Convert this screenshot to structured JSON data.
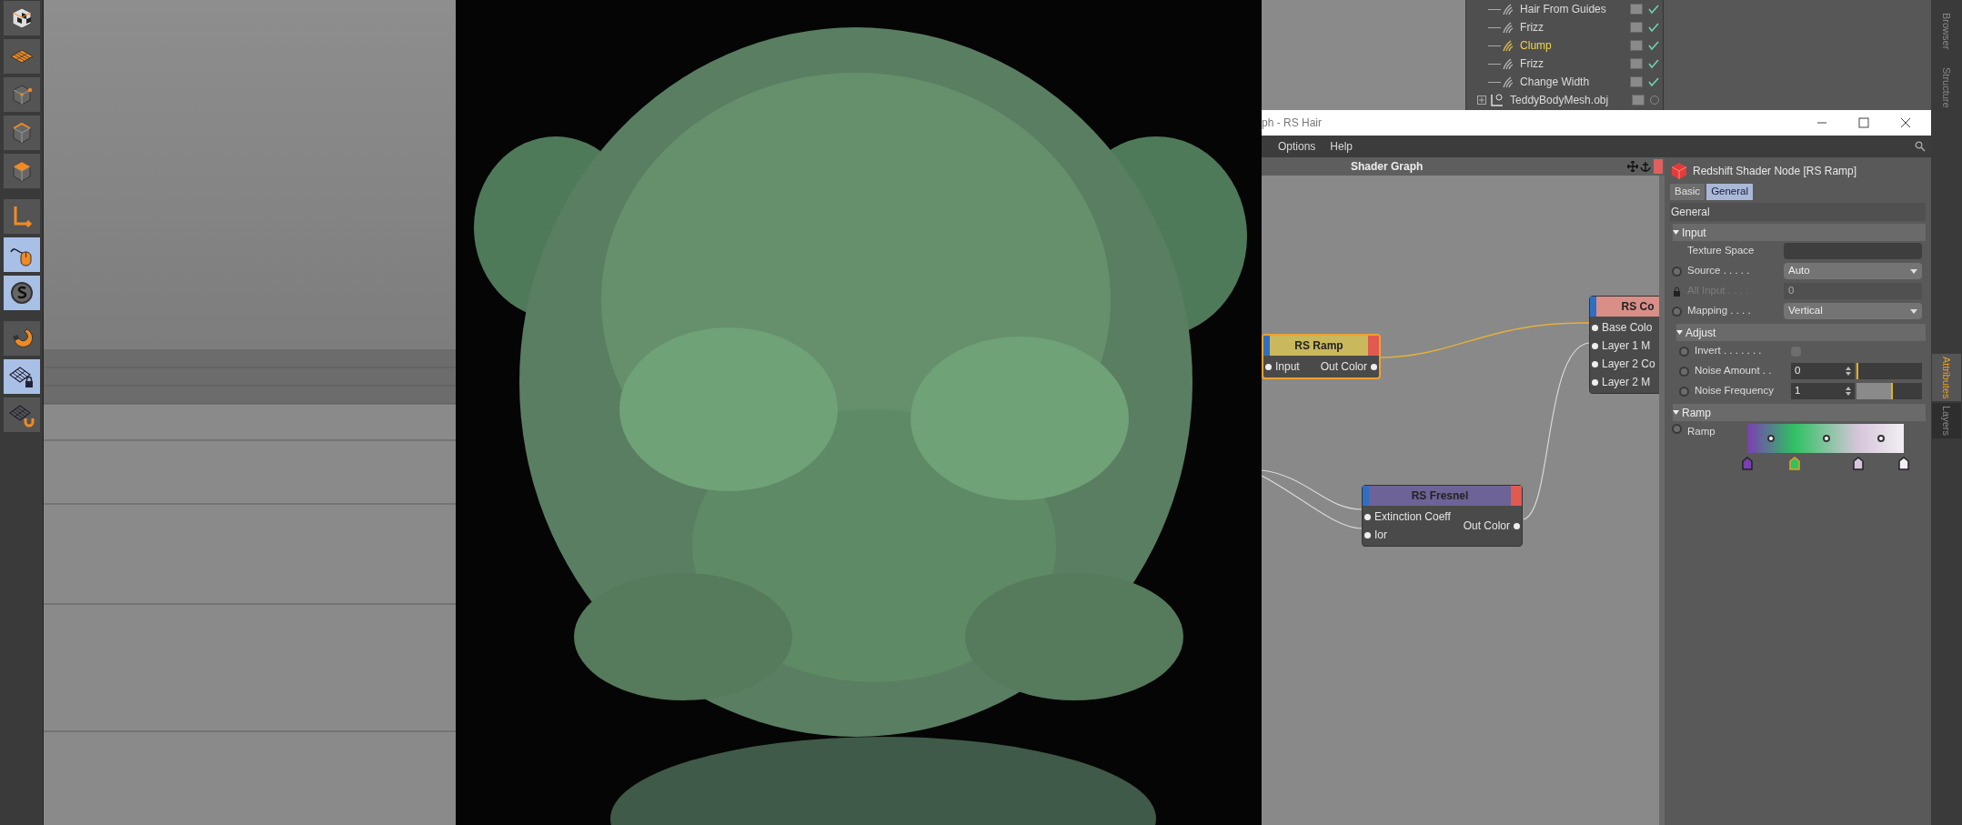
{
  "toolbar": {
    "tools": [
      {
        "kind": "checker-cube",
        "selected": false
      },
      {
        "kind": "grid-plane",
        "selected": false
      },
      {
        "kind": "cube-point",
        "selected": false
      },
      {
        "kind": "cube-edge",
        "selected": false
      },
      {
        "kind": "cube-face",
        "selected": false
      },
      {
        "kind": "axis",
        "selected": false
      },
      {
        "kind": "mouse",
        "selected": true
      },
      {
        "kind": "snap",
        "selected": true
      },
      {
        "kind": "magnet",
        "selected": false
      },
      {
        "kind": "grid-lock",
        "selected": true
      },
      {
        "kind": "grid-magnet",
        "selected": false
      }
    ]
  },
  "object_manager": {
    "items": [
      {
        "name": "Hair From Guides",
        "kind": "generator",
        "selected": false,
        "checked": true
      },
      {
        "name": "Frizz",
        "kind": "generator",
        "selected": false,
        "checked": true
      },
      {
        "name": "Clump",
        "kind": "generator",
        "selected": true,
        "checked": true
      },
      {
        "name": "Frizz",
        "kind": "generator",
        "selected": false,
        "checked": true
      },
      {
        "name": "Change Width",
        "kind": "generator",
        "selected": false,
        "checked": true
      },
      {
        "name": "TeddyBodyMesh.obj",
        "kind": "object",
        "selected": false,
        "checked": false
      }
    ]
  },
  "side_tabs_top": [
    "Browser",
    "Structure"
  ],
  "side_tabs_bottom": [
    {
      "label": "Attributes",
      "selected": true
    },
    {
      "label": "Layers",
      "selected": false
    }
  ],
  "window": {
    "title": "ph - RS Hair",
    "menu": [
      "Options",
      "Help"
    ]
  },
  "shader_graph": {
    "title": "Shader Graph",
    "nodes": [
      {
        "title": "RS Ramp",
        "color": "#c9b85c",
        "selected": true,
        "inputs": [
          "Input"
        ],
        "outputs": [
          "Out Color"
        ]
      },
      {
        "title": "RS Co",
        "color": "#d98e88",
        "selected": false,
        "inputs": [
          "Base Colo",
          "Layer 1 M",
          "Layer 2 Co",
          "Layer 2 M"
        ]
      },
      {
        "title": "RS Fresnel",
        "color": "#6e6396",
        "selected": false,
        "inputs": [
          "Extinction Coeff",
          "Ior"
        ],
        "outputs": [
          "Out Color"
        ]
      }
    ]
  },
  "attributes": {
    "header": "Redshift Shader Node [RS Ramp]",
    "tabs": [
      {
        "label": "Basic",
        "selected": false
      },
      {
        "label": "General",
        "selected": true
      }
    ],
    "section": "General",
    "groups": [
      {
        "title": "Input",
        "rows": [
          {
            "kind": "field",
            "label": "Texture Space",
            "disabled": false
          },
          {
            "kind": "dropdown",
            "label": "Source . . . . .",
            "value": "Auto",
            "disabled": false
          },
          {
            "kind": "number",
            "label": "All Input . . . .",
            "value": "0",
            "disabled": true
          },
          {
            "kind": "dropdown",
            "label": "Mapping . . . .",
            "value": "Vertical",
            "disabled": false
          }
        ]
      },
      {
        "title": "Adjust",
        "rows": [
          {
            "kind": "checkbox",
            "label": "Invert . . . . . . .",
            "checked": false,
            "disabled": false
          },
          {
            "kind": "slider",
            "label": "Noise Amount . .",
            "value": "0",
            "level": 0,
            "disabled": false
          },
          {
            "kind": "slider",
            "label": "Noise Frequency",
            "value": "1",
            "level": 0.55,
            "disabled": false
          }
        ]
      },
      {
        "title": "Ramp",
        "rows": [
          {
            "kind": "ramp",
            "label": "Ramp",
            "disabled": false,
            "knots": [
              {
                "color": "#7b3fb2",
                "selected": false
              },
              {
                "color": "#2fc162",
                "selected": true
              },
              {
                "color": "#d6c6da",
                "selected": false
              },
              {
                "color": "#f2eef4",
                "selected": false
              }
            ]
          }
        ]
      }
    ]
  }
}
